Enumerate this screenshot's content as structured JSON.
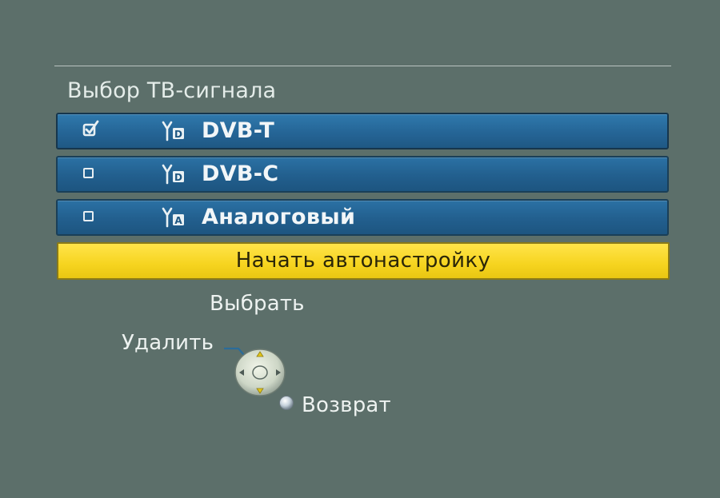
{
  "menu": {
    "title": "Выбор ТВ-сигнала",
    "options": [
      {
        "label": "DVB-T",
        "checked": true,
        "icon": "antenna-digital-icon",
        "badge": "D"
      },
      {
        "label": "DVB-C",
        "checked": false,
        "icon": "antenna-digital-icon",
        "badge": "D"
      },
      {
        "label": "Аналоговый",
        "checked": false,
        "icon": "antenna-analog-icon",
        "badge": "A"
      }
    ],
    "start_button": "Начать автонастройку"
  },
  "hints": {
    "select": "Выбрать",
    "delete": "Удалить",
    "return": "Возврат"
  },
  "colors": {
    "background": "#5c6f6a",
    "row_blue": "#2565964",
    "highlight_yellow": "#f6d41f"
  }
}
